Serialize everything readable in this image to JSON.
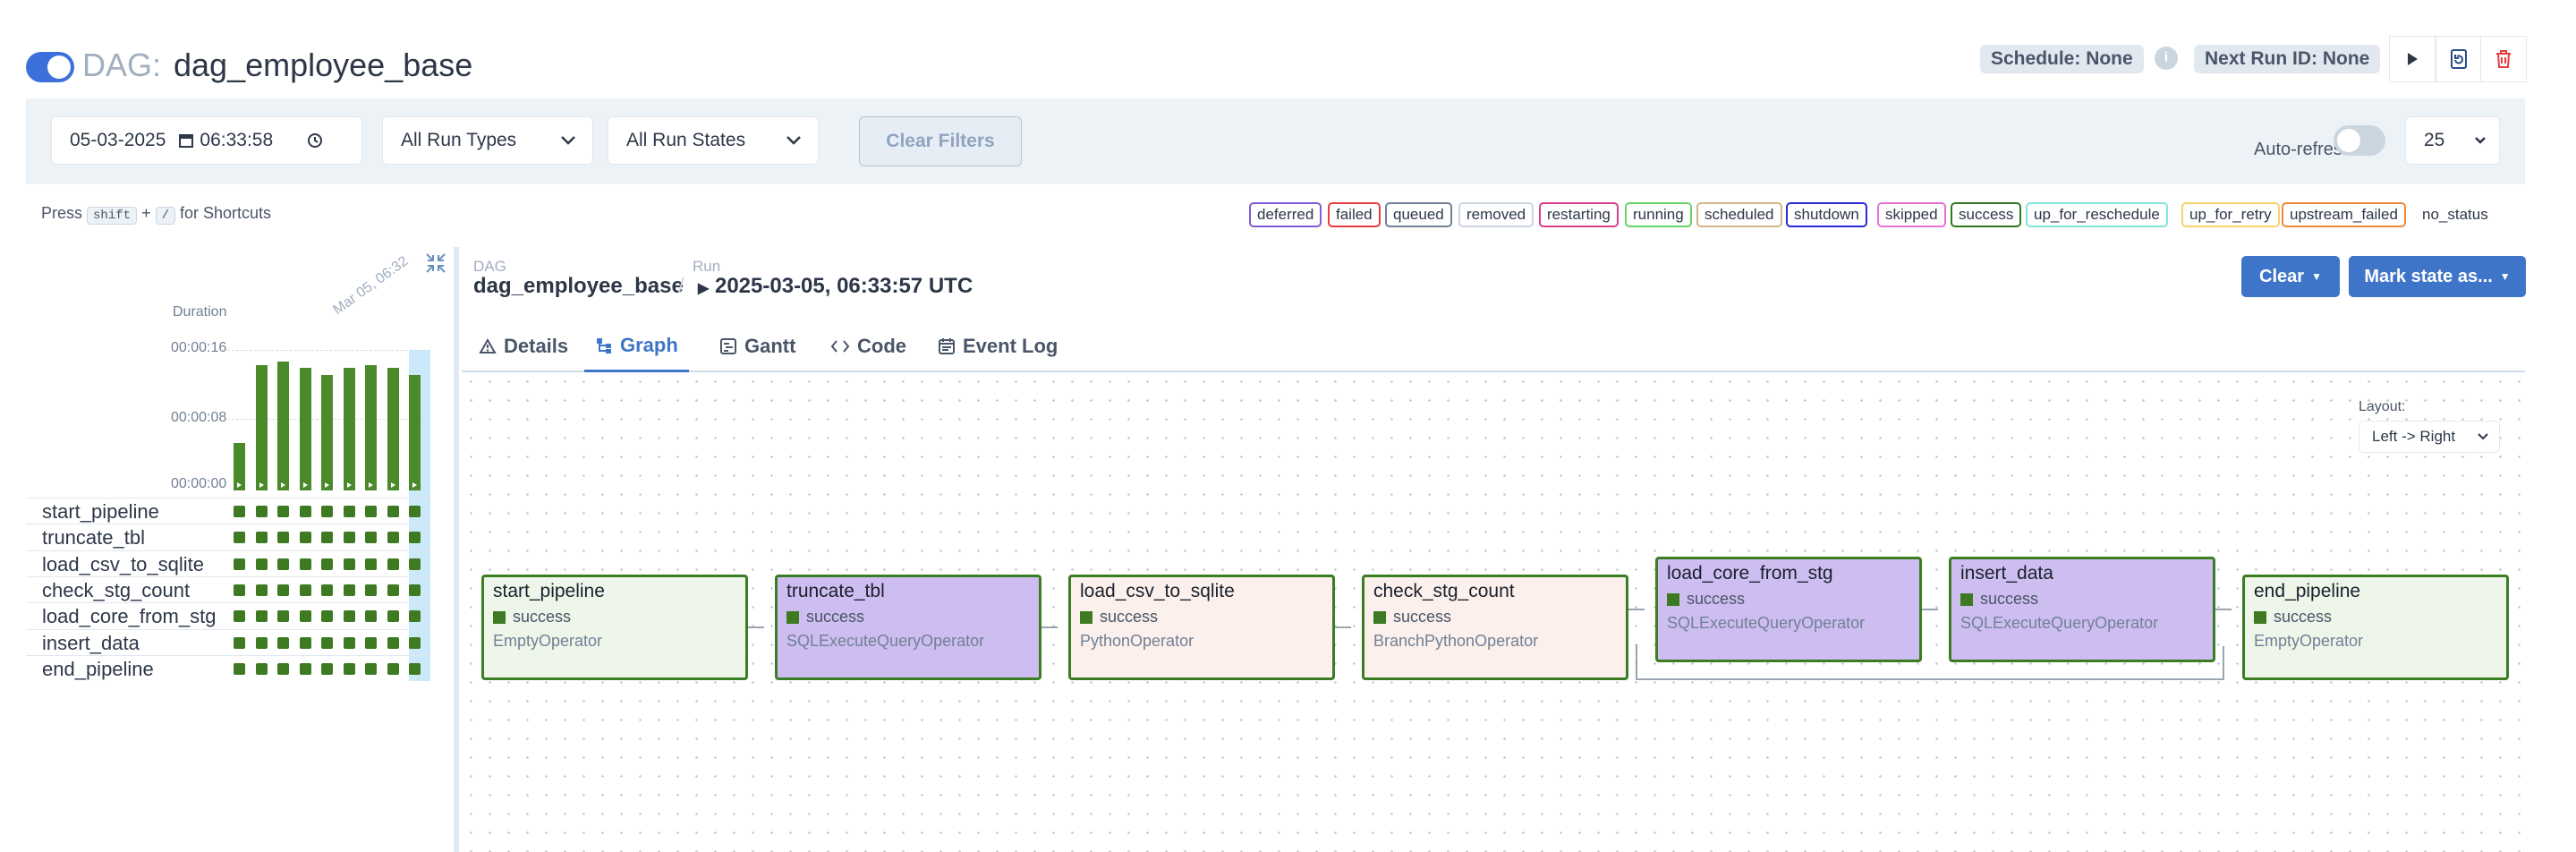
{
  "header": {
    "dag_prefix": "DAG:",
    "dag_id": "dag_employee_base",
    "schedule": "Schedule: None",
    "next_run": "Next Run ID: None"
  },
  "filters": {
    "datetime": "05-03-2025",
    "time": "06:33:58",
    "run_types": "All Run Types",
    "run_states": "All Run States",
    "clear_filters": "Clear Filters",
    "auto_refresh": "Auto-refresh",
    "page_size": "25"
  },
  "shortcuts": {
    "press": "Press",
    "key1": "shift",
    "plus": "+",
    "key2": "/",
    "suffix": "for Shortcuts"
  },
  "legend": [
    {
      "label": "deferred",
      "color": "#805ad5"
    },
    {
      "label": "failed",
      "color": "#e53e3e"
    },
    {
      "label": "queued",
      "color": "#718096"
    },
    {
      "label": "removed",
      "color": "#cbd5e0"
    },
    {
      "label": "restarting",
      "color": "#d53f8c"
    },
    {
      "label": "running",
      "color": "#68d368"
    },
    {
      "label": "scheduled",
      "color": "#d2b48c"
    },
    {
      "label": "shutdown",
      "color": "#2b2bd6"
    },
    {
      "label": "skipped",
      "color": "#e572d6"
    },
    {
      "label": "success",
      "color": "#2f7a1f"
    },
    {
      "label": "up_for_reschedule",
      "color": "#81e6d9"
    },
    {
      "label": "up_for_retry",
      "color": "#f6d36b"
    },
    {
      "label": "upstream_failed",
      "color": "#ed8936"
    },
    {
      "label": "no_status",
      "color": "transparent"
    }
  ],
  "grid": {
    "duration_label": "Duration",
    "date_label": "Mar 05, 06:32",
    "yticks": [
      "00:00:16",
      "00:00:08",
      "00:00:00"
    ],
    "run_durations_fraction": [
      0.35,
      0.93,
      0.96,
      0.91,
      0.86,
      0.91,
      0.93,
      0.91,
      0.86
    ],
    "tasks": [
      "start_pipeline",
      "truncate_tbl",
      "load_csv_to_sqlite",
      "check_stg_count",
      "load_core_from_stg",
      "insert_data",
      "end_pipeline"
    ]
  },
  "run_header": {
    "dag_small": "DAG",
    "dag_id": "dag_employee_base",
    "sep": "/",
    "run_small": "Run",
    "run_id": "2025-03-05, 06:33:57 UTC",
    "clear_btn": "Clear",
    "mark_btn": "Mark state as..."
  },
  "tabs": [
    {
      "label": "Details",
      "icon": "warning-triangle-icon"
    },
    {
      "label": "Graph",
      "icon": "graph-icon"
    },
    {
      "label": "Gantt",
      "icon": "gantt-icon"
    },
    {
      "label": "Code",
      "icon": "code-icon"
    },
    {
      "label": "Event Log",
      "icon": "calendar-icon"
    }
  ],
  "graph": {
    "layout_label": "Layout:",
    "layout_value": "Left -> Right",
    "nodes": [
      {
        "name": "start_pipeline",
        "state": "success",
        "operator": "EmptyOperator",
        "fill": "#eef6ea"
      },
      {
        "name": "truncate_tbl",
        "state": "success",
        "operator": "SQLExecuteQueryOperator",
        "fill": "#cdbdf0"
      },
      {
        "name": "load_csv_to_sqlite",
        "state": "success",
        "operator": "PythonOperator",
        "fill": "#fbf0eb"
      },
      {
        "name": "check_stg_count",
        "state": "success",
        "operator": "BranchPythonOperator",
        "fill": "#fbf0eb"
      },
      {
        "name": "load_core_from_stg",
        "state": "success",
        "operator": "SQLExecuteQueryOperator",
        "fill": "#cdbdf0"
      },
      {
        "name": "insert_data",
        "state": "success",
        "operator": "SQLExecuteQueryOperator",
        "fill": "#cdbdf0"
      },
      {
        "name": "end_pipeline",
        "state": "success",
        "operator": "EmptyOperator",
        "fill": "#eef6ea"
      }
    ]
  }
}
